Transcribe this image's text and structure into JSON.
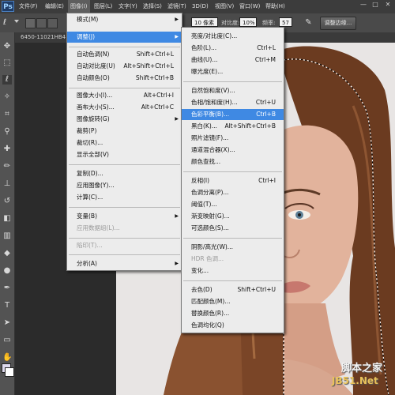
{
  "app": {
    "logo": "Ps"
  },
  "menubar": {
    "items": [
      {
        "label": "文件(F)"
      },
      {
        "label": "编辑(E)"
      },
      {
        "label": "图像(I)"
      },
      {
        "label": "图层(L)"
      },
      {
        "label": "文字(Y)"
      },
      {
        "label": "选择(S)"
      },
      {
        "label": "滤镜(T)"
      },
      {
        "label": "3D(D)"
      },
      {
        "label": "视图(V)"
      },
      {
        "label": "窗口(W)"
      },
      {
        "label": "帮助(H)"
      }
    ],
    "window_controls": [
      "—",
      "□",
      "✕"
    ]
  },
  "options_bar": {
    "tolerance_value": "10 像素",
    "contrast_label": "对比度:",
    "contrast_value": "10%",
    "frequency_label": "频率:",
    "frequency_value": "57",
    "refine_edge_button": "调整边缘..."
  },
  "document": {
    "tab_title": "6450-11021HB41…"
  },
  "image_menu": {
    "items": [
      {
        "label": "模式(M)",
        "shortcut": "",
        "submenu": true
      },
      {
        "label": "调整(J)",
        "shortcut": "",
        "submenu": true,
        "highlighted": true
      },
      {
        "label": "自动色调(N)",
        "shortcut": "Shift+Ctrl+L"
      },
      {
        "label": "自动对比度(U)",
        "shortcut": "Alt+Shift+Ctrl+L"
      },
      {
        "label": "自动颜色(O)",
        "shortcut": "Shift+Ctrl+B"
      },
      {
        "label": "图像大小(I)...",
        "shortcut": "Alt+Ctrl+I"
      },
      {
        "label": "画布大小(S)...",
        "shortcut": "Alt+Ctrl+C"
      },
      {
        "label": "图像旋转(G)",
        "shortcut": "",
        "submenu": true
      },
      {
        "label": "裁剪(P)",
        "shortcut": ""
      },
      {
        "label": "裁切(R)...",
        "shortcut": ""
      },
      {
        "label": "显示全部(V)",
        "shortcut": ""
      },
      {
        "label": "复制(D)...",
        "shortcut": ""
      },
      {
        "label": "应用图像(Y)...",
        "shortcut": ""
      },
      {
        "label": "计算(C)...",
        "shortcut": ""
      },
      {
        "label": "变量(B)",
        "shortcut": "",
        "submenu": true
      },
      {
        "label": "应用数据组(L)...",
        "shortcut": "",
        "disabled": true
      },
      {
        "label": "陷印(T)...",
        "shortcut": "",
        "disabled": true
      },
      {
        "label": "分析(A)",
        "shortcut": "",
        "submenu": true
      }
    ]
  },
  "adjust_submenu": {
    "items": [
      {
        "label": "亮度/对比度(C)...",
        "shortcut": ""
      },
      {
        "label": "色阶(L)...",
        "shortcut": "Ctrl+L"
      },
      {
        "label": "曲线(U)...",
        "shortcut": "Ctrl+M"
      },
      {
        "label": "曝光度(E)...",
        "shortcut": ""
      },
      {
        "label": "自然饱和度(V)...",
        "shortcut": ""
      },
      {
        "label": "色相/饱和度(H)...",
        "shortcut": "Ctrl+U"
      },
      {
        "label": "色彩平衡(B)...",
        "shortcut": "Ctrl+B",
        "highlighted": true
      },
      {
        "label": "黑白(K)...",
        "shortcut": "Alt+Shift+Ctrl+B"
      },
      {
        "label": "照片滤镜(F)...",
        "shortcut": ""
      },
      {
        "label": "通道混合器(X)...",
        "shortcut": ""
      },
      {
        "label": "颜色查找...",
        "shortcut": ""
      },
      {
        "label": "反相(I)",
        "shortcut": "Ctrl+I"
      },
      {
        "label": "色调分离(P)...",
        "shortcut": ""
      },
      {
        "label": "阈值(T)...",
        "shortcut": ""
      },
      {
        "label": "渐变映射(G)...",
        "shortcut": ""
      },
      {
        "label": "可选颜色(S)...",
        "shortcut": ""
      },
      {
        "label": "阴影/高光(W)...",
        "shortcut": ""
      },
      {
        "label": "HDR 色调...",
        "shortcut": "",
        "disabled": true
      },
      {
        "label": "变化...",
        "shortcut": ""
      },
      {
        "label": "去色(D)",
        "shortcut": "Shift+Ctrl+U"
      },
      {
        "label": "匹配颜色(M)...",
        "shortcut": ""
      },
      {
        "label": "替换颜色(R)...",
        "shortcut": ""
      },
      {
        "label": "色调均化(Q)",
        "shortcut": ""
      }
    ]
  },
  "watermark": {
    "line1": "脚本之家",
    "line2": "JB51.Net"
  },
  "colors": {
    "menu_highlight": "#3f89e3",
    "menubar_bg": "#3c3c3c",
    "toolbar_bg": "#535353"
  }
}
